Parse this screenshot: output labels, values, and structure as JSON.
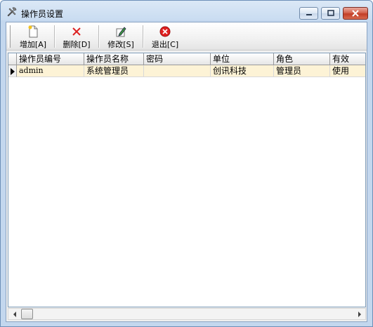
{
  "window": {
    "title": "操作员设置",
    "app_icon": "tools-icon",
    "controls": {
      "minimize_icon": "minimize-icon",
      "maximize_icon": "maximize-icon",
      "close_icon": "close-icon"
    }
  },
  "toolbar": {
    "buttons": [
      {
        "id": "add",
        "label": "增加[A]",
        "icon": "new-document-icon"
      },
      {
        "id": "delete",
        "label": "删除[D]",
        "icon": "delete-x-icon"
      },
      {
        "id": "edit",
        "label": "修改[S]",
        "icon": "edit-pencil-icon"
      },
      {
        "id": "exit",
        "label": "退出[C]",
        "icon": "exit-circle-icon"
      }
    ]
  },
  "grid": {
    "columns": [
      "操作员编号",
      "操作员名称",
      "密码",
      "单位",
      "角色",
      "有效"
    ],
    "rows": [
      {
        "cells": [
          "admin",
          "系统管理员",
          "",
          "创讯科技",
          "管理员",
          "使用"
        ],
        "selected": true
      }
    ]
  },
  "colors": {
    "selected_row": "#fdf3d6",
    "title_gradient_top": "#dbe8f6",
    "close_button": "#c23e27"
  }
}
